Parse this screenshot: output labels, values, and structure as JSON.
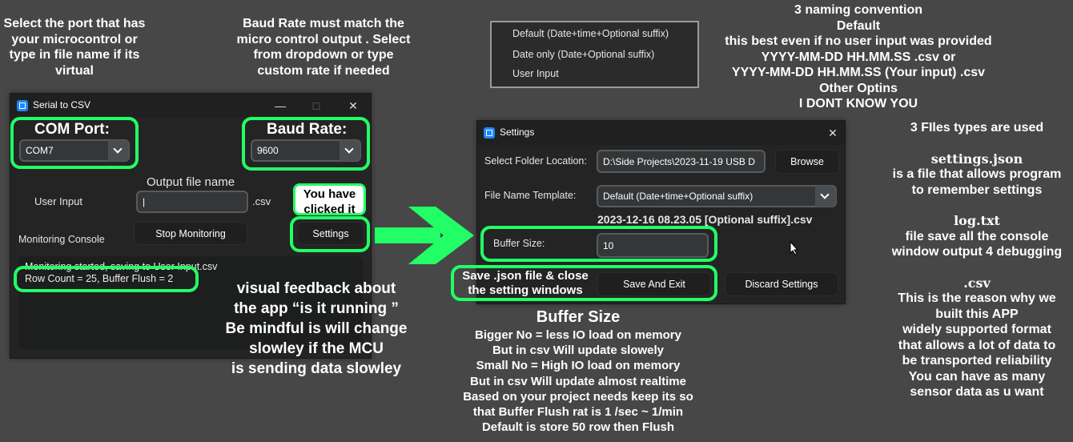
{
  "notes": {
    "port": [
      "Select the port that has",
      "your microcontrol or",
      "type in file name if its",
      "virtual"
    ],
    "baud": [
      "Baud Rate must match the",
      "micro control output . Select",
      "from dropdown or type",
      "custom rate if needed"
    ],
    "naming": [
      "3 naming convention",
      "Default",
      "this best even if no user input was provided",
      "YYYY-MM-DD HH.MM.SS .csv    or",
      "YYYY-MM-DD HH.MM.SS (Your input) .csv",
      "Other Optins",
      "I DONT KNOW YOU"
    ],
    "files_title": "3 FIles types are used",
    "settings_json_title": "settings.json",
    "settings_json_desc": [
      "is a file that allows program",
      "to remember settings"
    ],
    "log_title": "log.txt",
    "log_desc": [
      "file save all the console",
      "window output 4 debugging"
    ],
    "csv_title": ".csv",
    "csv_desc": [
      "This is the reason why we",
      "built this APP",
      "widely supported format",
      "that allows a lot of data to",
      "be transported reliability",
      "You can have as many",
      "sensor data as u want"
    ],
    "feedback": [
      "visual feedback about",
      "the app  “is it running ”",
      "Be mindful is will change",
      "slowley if the MCU",
      "is sending data slowley"
    ],
    "buffer_title": "Buffer Size",
    "buffer_desc": [
      "Bigger No = less IO load on memory",
      "But in csv Will update slowely",
      "Small No = High IO load on memory",
      "But in csv Will update almost realtime",
      "Based on your project needs keep its so",
      "that  Buffer Flush rat is 1 /sec ~  1/min",
      "Default is store 50 row then Flush"
    ],
    "clicked": [
      "You have",
      "clicked it"
    ],
    "save_note": [
      "Save .json file & close",
      "the setting windows"
    ]
  },
  "dropdown_menu": {
    "options": [
      "Default (Date+time+Optional suffix)",
      "Date only (Date+Optional suffix)",
      "User Input"
    ]
  },
  "serial_window": {
    "title": "Serial to CSV",
    "com_port_label": "COM Port:",
    "com_port_value": "COM7",
    "baud_rate_label": "Baud Rate:",
    "baud_rate_value": "9600",
    "output_file_label": "Output file name",
    "user_input_label": "User Input",
    "file_value": "|",
    "csv_suffix": ".csv",
    "monitoring_label": "Monitoring Console",
    "stop_button": "Stop Monitoring",
    "settings_button": "Settings",
    "console_lines": [
      "Monitoring started, saving to User Input.csv",
      "Row Count = 25, Buffer Flush = 2"
    ]
  },
  "settings_window": {
    "title": "Settings",
    "folder_label": "Select Folder Location:",
    "folder_value": "D:\\Side Projects\\2023-11-19 USB D",
    "browse_button": "Browse",
    "template_label": "File Name Template:",
    "template_value": "Default (Date+time+Optional suffix)",
    "preview": "2023-12-16 08.23.05 [Optional suffix].csv",
    "buffer_label": "Buffer Size:",
    "buffer_value": "10",
    "save_button": "Save And Exit",
    "discard_button": "Discard Settings"
  },
  "colors": {
    "highlight": "#22ff66",
    "background": "#474747",
    "window": "#242424",
    "accent": "#1e88ff"
  }
}
